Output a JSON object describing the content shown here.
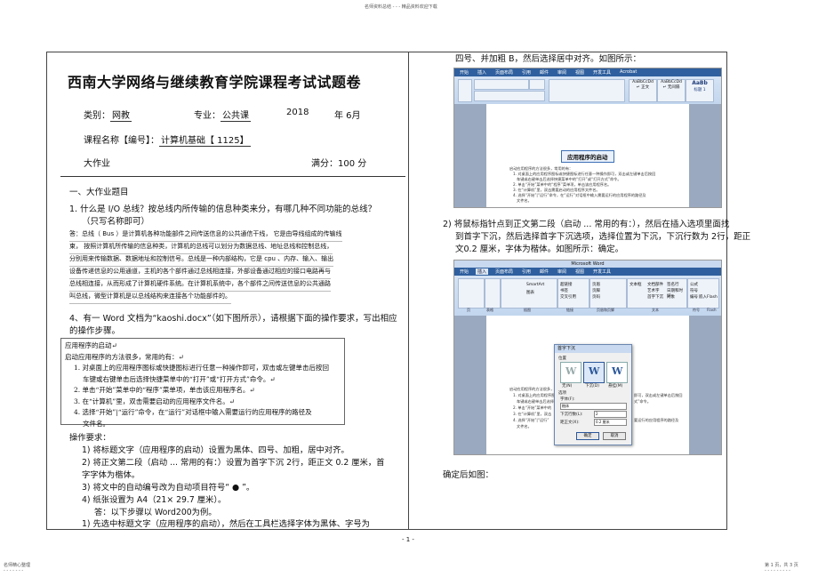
{
  "header_note": "名师资料总结 - - - 精品资料欢迎下载",
  "footer": {
    "left": "名师精心整理",
    "left_dots": "- - - - - - -",
    "page_number": "- 1 -",
    "right": "第 1 页，共 3 页",
    "right_dots": "- - - - - - - - -"
  },
  "exam": {
    "title": "西南大学网络与继续教育学院课程考试试题卷",
    "category_label": "类别：",
    "category_value": "网教",
    "major_label": "专业：",
    "major_value": "公共课",
    "year": "2018",
    "month_label": "年 6月",
    "course_label": "课程名称【编号】：",
    "course_value": "计算机基础【  1125】",
    "homework": "大作业",
    "score": "满分：100 分"
  },
  "section1": {
    "heading": "一、大作业题目",
    "q1_line1": "1.  什么是   I/O  总线？按总线内所传输的信息种类来分，有哪几种不同功能的总线？",
    "q1_line2": "（只写名称即可）",
    "answer_lines": [
      "答：总线（ Bus ）是计算机各种功能部件之间传送信息的公共通信干线，           它是由导线组成的传输线",
      "束，   按照计算机所传输的信息种类，计算机的总线可以划分为数据总线、地址总线和控制总线，",
      "分别用来传输数据、数据地址和控制信号。总线是一种内部结构，它是            cpu 、内存、输入、输出",
      "设备传递信息的公用通道，主机的各个部件通过总线相连接，外部设备通过相应的接口电路再与",
      "总线相连接，从而形成了计算机硬件系统。在计算机系统中，各个部件之间传送信息的公共通路",
      "叫总线，微型计算机是以总线结构来连接各个功能部件的。"
    ],
    "q4_line1": "4、有一 Word 文档为“kaoshi.docx”（如下图所示），请根据下面的操作要求，写出相应",
    "q4_line2": "的操作步骤。"
  },
  "doc_sample": {
    "title": "应用程序的启动↵",
    "lines": [
      "启动应用程序的方法很多，常用的有：↵",
      "1.  对桌面上的应用程序图标或快捷图标进行任意一种操作即可，双击或左键单击后按回",
      "车键或右键单击后选择快捷菜单中的“打开”或“打开方式”命令。↵",
      "2.  单击“开始”菜单中的“程序”菜单项，单击该应用程序名。↵",
      "3.  在“计算机”里，双击需要启动的应用程序文件名。↵",
      "4.  选择“开始”|“运行”命令，在“运行”对话框中输入需要运行的应用程序的路径及",
      "文件名。"
    ]
  },
  "requirements": {
    "heading": "操作要求：",
    "items": [
      "1) 将标题文字（应用程序的启动）设置为黑体、四号、加粗，居中对齐。",
      "2) 将正文第二段（启动   ...  常用的有：）设置为首字下沉    2行，距正文 0.2 厘米，首",
      "字字体为楷体。",
      "3) 将文中的自动编号改为自动项目符号“  ● ”。",
      "4) 纸张设置为  A4（21× 29.7  厘米）。",
      "答：以下步骤以  Word200为例。",
      "1)   先选中标题文字（应用程序的启动），然后在工具栏选择字体为黑体、字号为"
    ]
  },
  "right_col": {
    "top_line": "四号、并加粗 B，然后选择居中对齐。如图所示：",
    "step2_line1": "2)   将鼠标指针点到正文第二段（启动   ...   常用的有：），然后在插入选项里面找",
    "step2_line2": "到首字下沉，然后选择首字下沉选项，选择位置为下沉，下沉行数为       2行，距正",
    "step2_line3": "文0.2 厘米，字体为楷体。如图所示：确定。",
    "confirm_caption": "确定后如图："
  },
  "screenshot1": {
    "tabs": [
      "开始",
      "插入",
      "页面布局",
      "引用",
      "邮件",
      "审阅",
      "视图",
      "开发工具",
      "Acrobat"
    ],
    "style_labels": [
      "AaBbCcDd",
      "AaBbCcDd",
      "AaBb"
    ],
    "style_names": [
      "↵ 正文",
      "↵ 无间隔",
      "标题 1"
    ],
    "heading_text": "应用程序的启动",
    "body_lines": [
      "启动应用程序的方法很多，常用的有：",
      "1.  对桌面上的应用程序图标或快捷图标进行任意一种操作即可，双击或左键单击后按回",
      "车键或右键单击后选择快捷菜单中的“打开”或“打开方式”命令。",
      "2.  单击“开始”菜单中的“程序”菜单项，单击该应用程序名。",
      "3.  在“计算机”里，双击需要启动的应用程序文件名。",
      "4.  选择“开始”|“运行”命令，在“运行”对话框中输入需要运行的应用程序的路径及",
      "文件名。"
    ]
  },
  "screenshot2": {
    "app_title": "Microsoft Word",
    "tabs": [
      "开始",
      "插入",
      "页面布局",
      "引用",
      "邮件",
      "审阅",
      "视图",
      "开发工具"
    ],
    "groups": [
      "页",
      "表格",
      "插图",
      "链接",
      "页眉和页脚",
      "文本",
      "符号",
      "Flash"
    ],
    "ribbon_items": [
      "SmartArt",
      "图表",
      "超链接",
      "书签",
      "交叉引用",
      "页眉",
      "页脚",
      "页码",
      "文本框",
      "文档部件",
      "艺术字",
      "首字下沉",
      "签名行",
      "日期和时间",
      "对象",
      "公式",
      "符号",
      "编号",
      "嵌入Flash"
    ],
    "dialog": {
      "title": "首字下沉",
      "position_label": "位置",
      "opt_none": "无(N)",
      "opt_drop": "下沉(D)",
      "opt_margin": "悬挂(M)",
      "options_label": "选项",
      "font_label": "字体(F):",
      "font_value": "楷体",
      "lines_label": "下沉行数(L):",
      "lines_value": "2",
      "distance_label": "距正文(X):",
      "distance_value": "0.2 厘米",
      "ok": "确定",
      "cancel": "取消"
    },
    "body_lines": [
      "启动应用程序的方法很多，",
      "1.  对桌面上的应用程序图",
      "车键或右键单击后选择",
      "2.  单击“开始”菜单中的",
      "3.  在“计算机”里，双击",
      "4.  选择“开始”|“运行”",
      "文件名。"
    ],
    "body_right_lines": [
      "即可，双击或左键单击后按回",
      "式”命令。",
      "",
      "",
      "要运行的应用程序的路径及",
      ""
    ]
  }
}
